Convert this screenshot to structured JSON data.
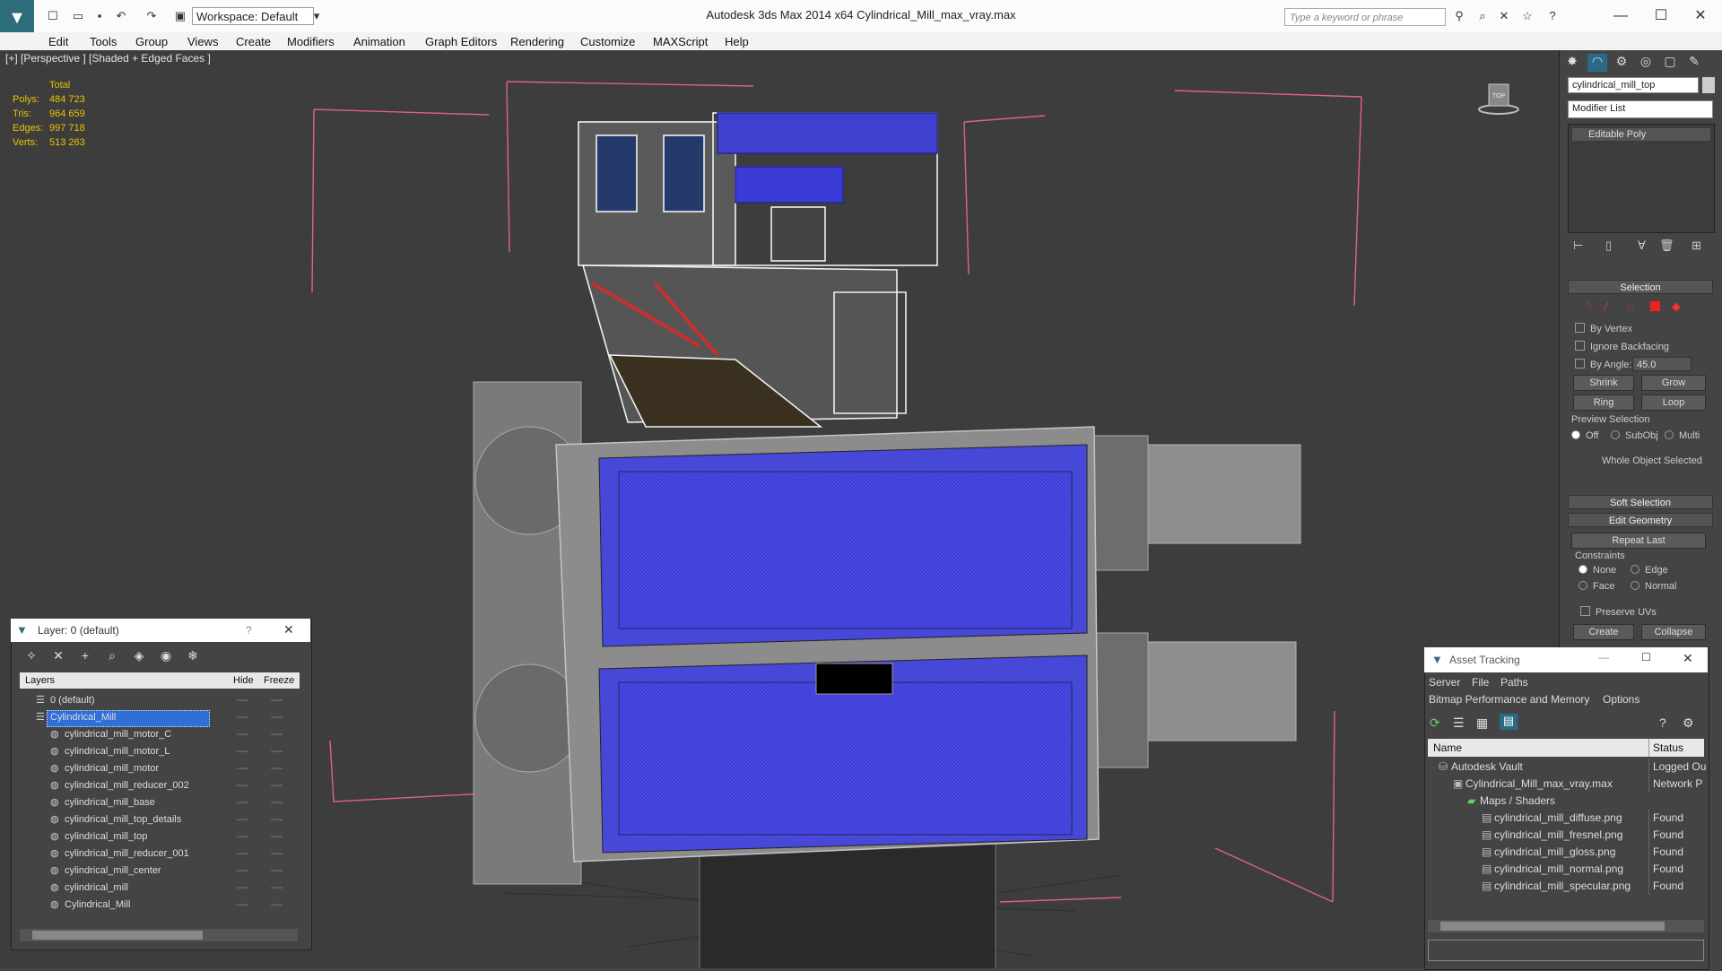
{
  "window": {
    "title": "Autodesk 3ds Max  2014 x64      Cylindrical_Mill_max_vray.max",
    "workspace": "Workspace: Default",
    "search_placeholder": "Type a keyword or phrase"
  },
  "menu": [
    "Edit",
    "Tools",
    "Group",
    "Views",
    "Create",
    "Modifiers",
    "Animation",
    "Graph Editors",
    "Rendering",
    "Customize",
    "MAXScript",
    "Help"
  ],
  "viewport": {
    "label": "[+] [Perspective ] [Shaded + Edged Faces ]",
    "stats": {
      "header": "Total",
      "rows": [
        {
          "label": "Polys:",
          "value": "484 723"
        },
        {
          "label": "Tris:",
          "value": "964 659"
        },
        {
          "label": "Edges:",
          "value": "997 718"
        },
        {
          "label": "Verts:",
          "value": "513 263"
        }
      ]
    },
    "viewcube_label": "TOP"
  },
  "command_panel": {
    "object_name": "cylindrical_mill_top",
    "modifier_list": "Modifier List",
    "modifier_stack": [
      "Editable Poly"
    ],
    "selection": {
      "title": "Selection",
      "by_vertex": "By Vertex",
      "ignore_backfacing": "Ignore Backfacing",
      "by_angle": "By Angle:",
      "angle_value": "45.0",
      "shrink": "Shrink",
      "grow": "Grow",
      "ring": "Ring",
      "loop": "Loop",
      "preview_title": "Preview Selection",
      "preview_off": "Off",
      "preview_subobj": "SubObj",
      "preview_multi": "Multi",
      "status": "Whole Object Selected"
    },
    "soft_selection": "Soft Selection",
    "edit_geometry": {
      "title": "Edit Geometry",
      "repeat_last": "Repeat Last",
      "constraints": "Constraints",
      "none": "None",
      "edge": "Edge",
      "face": "Face",
      "normal": "Normal",
      "preserve_uvs": "Preserve UVs",
      "create": "Create",
      "collapse": "Collapse"
    }
  },
  "layer_panel": {
    "title": "Layer: 0 (default)",
    "help": "?",
    "columns": {
      "layers": "Layers",
      "hide": "Hide",
      "freeze": "Freeze"
    },
    "rows": [
      {
        "name": "0 (default)",
        "indent": 0
      },
      {
        "name": "Cylindrical_Mill",
        "indent": 0,
        "selected": true
      },
      {
        "name": "cylindrical_mill_motor_C",
        "indent": 1
      },
      {
        "name": "cylindrical_mill_motor_L",
        "indent": 1
      },
      {
        "name": "cylindrical_mill_motor",
        "indent": 1
      },
      {
        "name": "cylindrical_mill_reducer_002",
        "indent": 1
      },
      {
        "name": "cylindrical_mill_base",
        "indent": 1
      },
      {
        "name": "cylindrical_mill_top_details",
        "indent": 1
      },
      {
        "name": "cylindrical_mill_top",
        "indent": 1
      },
      {
        "name": "cylindrical_mill_reducer_001",
        "indent": 1
      },
      {
        "name": "cylindrical_mill_center",
        "indent": 1
      },
      {
        "name": "cylindrical_mill",
        "indent": 1
      },
      {
        "name": "Cylindrical_Mill",
        "indent": 1
      }
    ],
    "dash": "----"
  },
  "asset_panel": {
    "title": "Asset Tracking",
    "menu1": [
      "Server",
      "File",
      "Paths"
    ],
    "menu2": [
      "Bitmap Performance and Memory",
      "Options"
    ],
    "columns": {
      "name": "Name",
      "status": "Status"
    },
    "rows": [
      {
        "name": "Autodesk Vault",
        "status": "Logged Ou",
        "indent": 0
      },
      {
        "name": "Cylindrical_Mill_max_vray.max",
        "status": "Network P",
        "indent": 1
      },
      {
        "name": "Maps / Shaders",
        "status": "",
        "indent": 2
      },
      {
        "name": "cylindrical_mill_diffuse.png",
        "status": "Found",
        "indent": 3
      },
      {
        "name": "cylindrical_mill_fresnel.png",
        "status": "Found",
        "indent": 3
      },
      {
        "name": "cylindrical_mill_gloss.png",
        "status": "Found",
        "indent": 3
      },
      {
        "name": "cylindrical_mill_normal.png",
        "status": "Found",
        "indent": 3
      },
      {
        "name": "cylindrical_mill_specular.png",
        "status": "Found",
        "indent": 3
      }
    ]
  },
  "colors": {
    "accent_blue": "#3a3ad6",
    "wire_gray": "#9a9a9a",
    "bbox_pink": "#e0608a",
    "stat_yellow": "#e8c400",
    "selected_layer": "#2f6fd6"
  }
}
